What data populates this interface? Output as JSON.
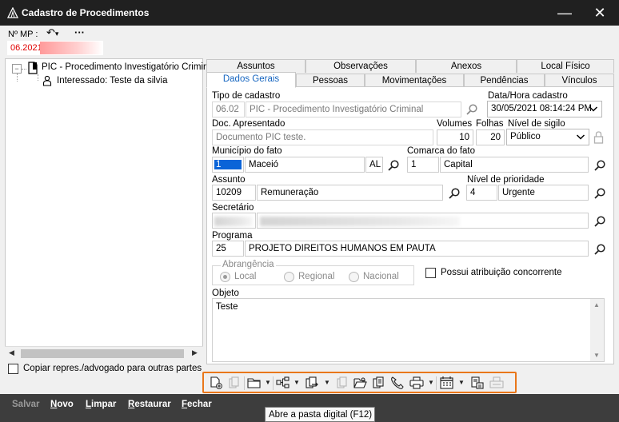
{
  "window": {
    "title": "Cadastro de Procedimentos",
    "minimize_glyph": "—",
    "close_glyph": "✕"
  },
  "mp": {
    "label": "Nº MP :",
    "value": "06.2021.",
    "undo_glyph": "↶",
    "undo_menu_glyph": "▾",
    "more_glyph": "···"
  },
  "tree": {
    "expander": "−",
    "root_label": "PIC - Procedimento Investigatório Criminal",
    "child_label": "Interessado: Teste da silvia"
  },
  "copy_checkbox": {
    "label": "Copiar repres./advogado para outras partes",
    "checked": false
  },
  "tabs_top": [
    {
      "label": "Assuntos"
    },
    {
      "label": "Observações"
    },
    {
      "label": "Anexos"
    },
    {
      "label": "Local Físico"
    }
  ],
  "tabs_bottom": [
    {
      "label": "Dados Gerais",
      "active": true
    },
    {
      "label": "Pessoas"
    },
    {
      "label": "Movimentações"
    },
    {
      "label": "Pendências"
    },
    {
      "label": "Vínculos"
    }
  ],
  "form": {
    "tipo_label": "Tipo de cadastro",
    "tipo_code": "06.02",
    "tipo_value": "PIC - Procedimento Investigatório Criminal",
    "data_label": "Data/Hora cadastro",
    "data_value": "30/05/2021 08:14:24 PM",
    "doc_label": "Doc. Apresentado",
    "doc_value": "Documento PIC teste.",
    "volumes_label": "Volumes",
    "volumes_value": "10",
    "folhas_label": "Folhas",
    "folhas_value": "20",
    "sigilo_label": "Nível de sigilo",
    "sigilo_value": "Público",
    "municipio_label": "Município do fato",
    "municipio_code": "1",
    "municipio_name": "Maceió",
    "municipio_uf": "AL",
    "comarca_label": "Comarca do fato",
    "comarca_code": "1",
    "comarca_name": "Capital",
    "assunto_label": "Assunto",
    "assunto_code": "10209",
    "assunto_name": "Remuneração",
    "prioridade_label": "Nível de prioridade",
    "prioridade_code": "4",
    "prioridade_name": "Urgente",
    "secretario_label": "Secretário",
    "programa_label": "Programa",
    "programa_code": "25",
    "programa_name": "PROJETO DIREITOS HUMANOS EM PAUTA",
    "abrangencia_label": "Abrangência",
    "abrangencia_options": [
      {
        "label": "Local",
        "selected": true
      },
      {
        "label": "Regional",
        "selected": false
      },
      {
        "label": "Nacional",
        "selected": false
      }
    ],
    "concorrente_label": "Possui atribuição concorrente",
    "concorrente_checked": false,
    "objeto_label": "Objeto",
    "objeto_value": "Teste"
  },
  "toolbar_icons": [
    "add-document-icon",
    "copy-document-icon",
    "folder-icon",
    "hierarchy-icon",
    "transfer-document-icon",
    "documents-icon",
    "open-folder-icon",
    "attach-document-icon",
    "phone-icon",
    "printer-icon",
    "calendar-icon",
    "edit-document-icon",
    "scan-icon"
  ],
  "bottom_buttons": {
    "salvar": "Salvar",
    "novo_underlined": "N",
    "novo_rest": "ovo",
    "limpar_underlined": "L",
    "limpar_rest": "impar",
    "restaurar_underlined": "R",
    "restaurar_rest": "estaurar",
    "fechar_underlined": "F",
    "fechar_rest": "echar"
  },
  "tooltip": "Abre a pasta digital (F12)",
  "colors": {
    "titlebar": "#202020",
    "accent_tab": "#1565c0",
    "mp_number": "#e00000",
    "toolbar_highlight": "#e9771a",
    "bottombar": "#3d3d3d",
    "selection": "#0a64d8"
  }
}
